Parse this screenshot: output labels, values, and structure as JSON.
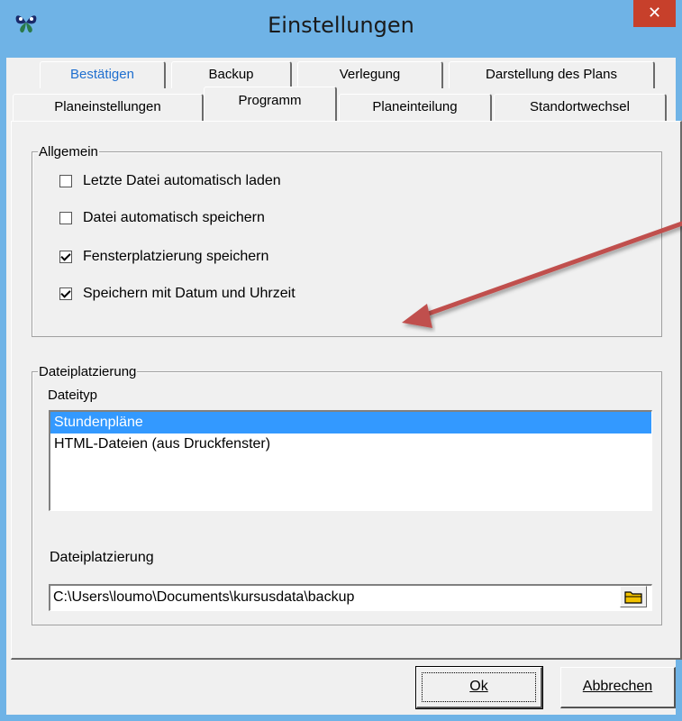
{
  "window": {
    "title": "Einstellungen",
    "close_glyph": "✕"
  },
  "tabs_row1": [
    {
      "label": "Bestätigen"
    },
    {
      "label": "Backup"
    },
    {
      "label": "Verlegung"
    },
    {
      "label": "Darstellung des Plans"
    }
  ],
  "tabs_row2": [
    {
      "label": "Planeinstellungen"
    },
    {
      "label": "Programm"
    },
    {
      "label": "Planeinteilung"
    },
    {
      "label": "Standortwechsel"
    }
  ],
  "general": {
    "title": "Allgemein",
    "options": [
      {
        "label": "Letzte Datei automatisch laden",
        "checked": false
      },
      {
        "label": "Datei automatisch speichern",
        "checked": false
      },
      {
        "label": "Fensterplatzierung speichern",
        "checked": true
      },
      {
        "label": "Speichern mit Datum und Uhrzeit",
        "checked": true
      }
    ]
  },
  "file_location": {
    "title": "Dateiplatzierung",
    "type_label": "Dateityp",
    "types": [
      {
        "label": "Stundenpläne",
        "selected": true
      },
      {
        "label": "HTML-Dateien (aus Druckfenster)",
        "selected": false
      }
    ],
    "path_label": "Dateiplatzierung",
    "path_value": "C:\\Users\\loumo\\Documents\\kursusdata\\backup"
  },
  "buttons": {
    "ok": "Ok",
    "cancel": "Abbrechen"
  },
  "colors": {
    "titlebar": "#6fb3e6",
    "close": "#c7402b",
    "selection": "#3399ff",
    "annotation_arrow": "#c0504d",
    "link_tab": "#1f6fcf"
  },
  "icons": {
    "app": "butterfly-icon",
    "folder": "folder-icon"
  }
}
